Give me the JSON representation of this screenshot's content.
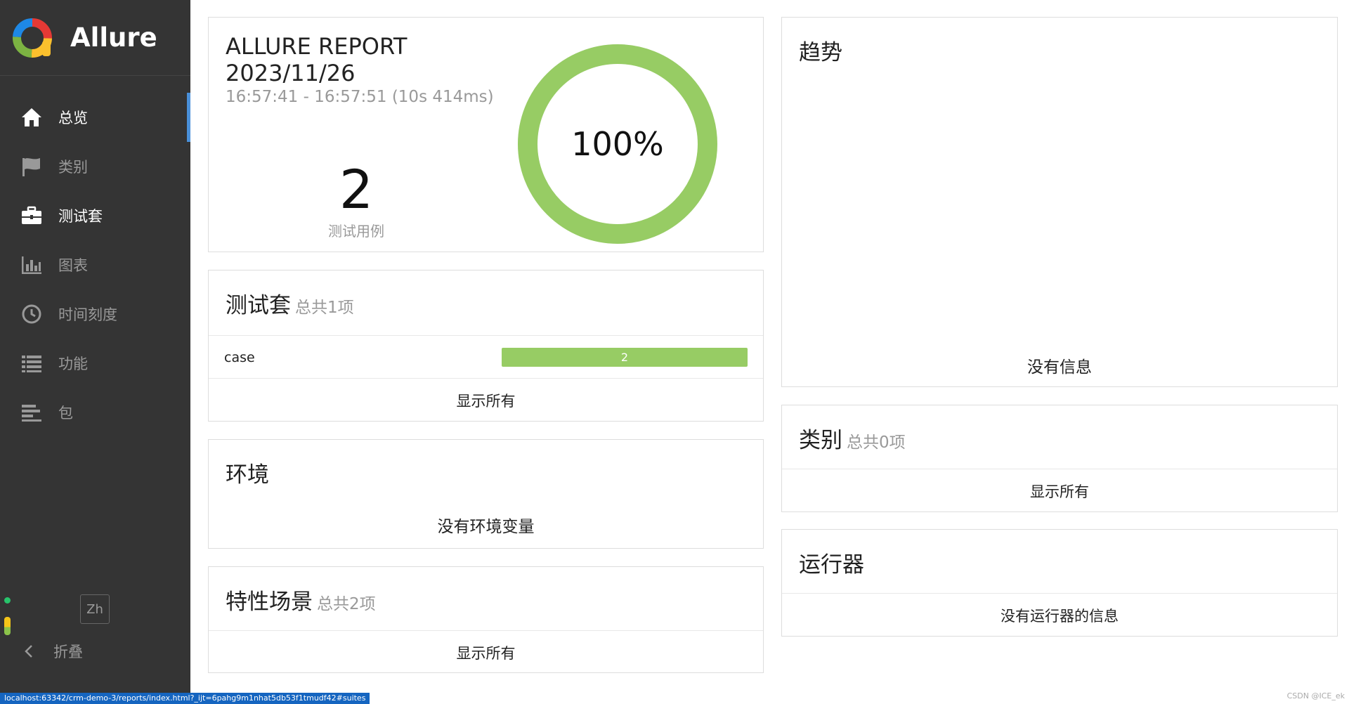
{
  "app": {
    "name": "Allure"
  },
  "sidebar": {
    "items": [
      {
        "label": "总览",
        "icon": "home-icon"
      },
      {
        "label": "类别",
        "icon": "flag-icon"
      },
      {
        "label": "测试套",
        "icon": "briefcase-icon"
      },
      {
        "label": "图表",
        "icon": "bar-chart-icon"
      },
      {
        "label": "时间刻度",
        "icon": "clock-icon"
      },
      {
        "label": "功能",
        "icon": "list-icon"
      },
      {
        "label": "包",
        "icon": "align-left-icon"
      }
    ],
    "language": "Zh",
    "collapse_label": "折叠"
  },
  "summary": {
    "title_line1": "ALLURE REPORT",
    "title_line2": "2023/11/26",
    "time_range": "16:57:41 - 16:57:51 (10s 414ms)",
    "test_count": "2",
    "test_count_label": "测试用例",
    "pass_rate": "100%",
    "pass_fraction": 1.0,
    "pass_color": "#97cc64"
  },
  "suites": {
    "title": "测试套",
    "subtitle": "总共1项",
    "rows": [
      {
        "name": "case",
        "count": "2"
      }
    ],
    "show_all": "显示所有"
  },
  "environment": {
    "title": "环境",
    "message": "没有环境变量"
  },
  "features": {
    "title": "特性场景",
    "subtitle": "总共2项",
    "show_all": "显示所有"
  },
  "trend": {
    "title": "趋势",
    "message": "没有信息"
  },
  "categories": {
    "title": "类别",
    "subtitle": "总共0项",
    "show_all": "显示所有"
  },
  "executors": {
    "title": "运行器",
    "message": "没有运行器的信息"
  },
  "status_bar": {
    "url": "localhost:63342/crm-demo-3/reports/index.html?_ijt=6pahg9m1nhat5db53f1tmudf42#suites"
  },
  "watermark": "CSDN @ICE_ek"
}
